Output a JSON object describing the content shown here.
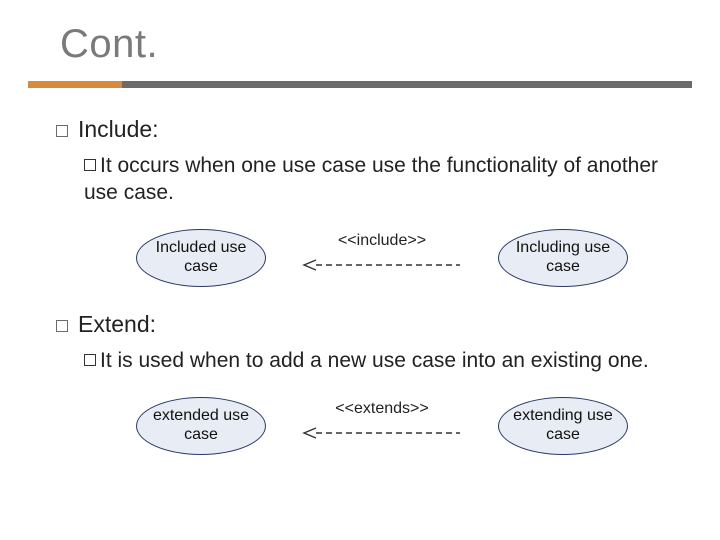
{
  "title": "Cont.",
  "sections": [
    {
      "heading": "Include:",
      "body_prefix": "It",
      "body": " occurs when one use case use the functionality of another use case.",
      "diagram": {
        "left": "Included use case",
        "label": "<<include>>",
        "right": "Including use case",
        "direction": "left"
      }
    },
    {
      "heading": "Extend:",
      "body_prefix": "It",
      "body": " is used when to add a new use case into an existing one.",
      "diagram": {
        "left": "extended use case",
        "label": "<<extends>>",
        "right": "extending use case",
        "direction": "left"
      }
    }
  ]
}
